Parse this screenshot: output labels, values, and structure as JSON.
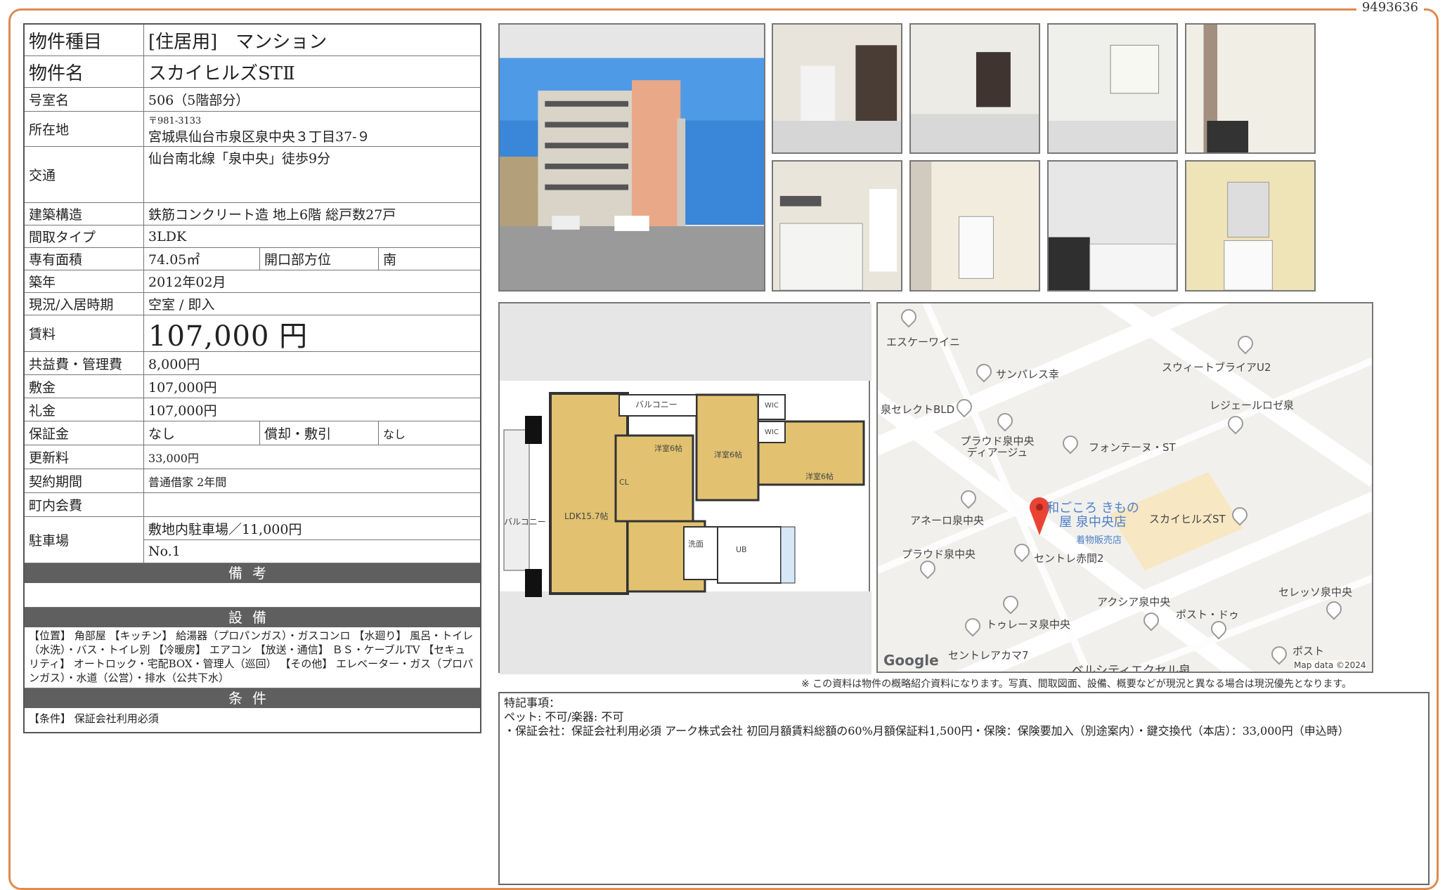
{
  "doc_id": "9493636",
  "spec": {
    "type_label": "物件種目",
    "type_value": "[住居用]　マンション",
    "name_label": "物件名",
    "name_value": "スカイヒルズSTⅡ",
    "room_label": "号室名",
    "room_value": "506（5階部分）",
    "address_label": "所在地",
    "postal": "〒981-3133",
    "address": "宮城県仙台市泉区泉中央３丁目37-９",
    "transit_label": "交通",
    "transit_value": "仙台南北線「泉中央」徒歩9分",
    "structure_label": "建築構造",
    "structure_value": "鉄筋コンクリート造 地上6階 総戸数27戸",
    "layout_label": "間取タイプ",
    "layout_value": "3LDK",
    "area_label": "専有面積",
    "area_value": "74.05㎡",
    "direction_label": "開口部方位",
    "direction_value": "南",
    "built_label": "築年",
    "built_value": "2012年02月",
    "status_label": "現況/入居時期",
    "status_value": "空室 / 即入",
    "rent_label": "賃料",
    "rent_value": "107,000 円",
    "fee_label": "共益費・管理費",
    "fee_value": "8,000円",
    "deposit_label": "敷金",
    "deposit_value": "107,000円",
    "keymoney_label": "礼金",
    "keymoney_value": "107,000円",
    "guarantee_label": "保証金",
    "guarantee_value": "なし",
    "amort_label": "償却・敷引",
    "amort_value": "なし",
    "renewal_label": "更新料",
    "renewal_value": "33,000円",
    "contract_label": "契約期間",
    "contract_value": "普通借家 2年間",
    "community_label": "町内会費",
    "community_value": "",
    "parking_label": "駐車場",
    "parking_value": "敷地内駐車場／11,000円",
    "parking_no": "No.1"
  },
  "sections": {
    "remarks_title": "備考",
    "facility_title": "設備",
    "facility_text": "【位置】 角部屋 【キッチン】 給湯器（プロパンガス）・ガスコンロ 【水廻り】 風呂・トイレ（水洗）・バス・トイレ別 【冷暖房】 エアコン 【放送・通信】 ＢＳ・ケーブルTV 【セキュリティ】 オートロック・宅配BOX・管理人（巡回） 【その他】 エレベーター・ガス（プロパンガス）・水道（公営）・排水（公共下水）",
    "condition_title": "条件",
    "condition_text": "【条件】 保証会社利用必須"
  },
  "floorplan": {
    "balcony_top": "バルコニー",
    "balcony_side": "バルコニー",
    "room1": "洋室6帖",
    "room2": "洋室6帖",
    "room3": "洋室6帖",
    "ldk": "LDK15.7帖",
    "cl": "CL",
    "wic1": "WIC",
    "wic2": "WIC",
    "wash": "洗面",
    "ub": "UB"
  },
  "map": {
    "labels": [
      "エスケーワイニ",
      "サンパレス幸",
      "泉セレクトBLD",
      "プラウド泉中央ディアージュ",
      "フォンテーヌ・ST",
      "スウィートブライアU2",
      "レジェールロゼ泉",
      "和ごころ きもの屋 泉中央店",
      "着物販売店",
      "スカイヒルズST",
      "アネーロ泉中央",
      "プラウド泉中央",
      "セントレ赤間2",
      "アクシア泉中央",
      "ポスト・ドゥ",
      "セレッソ泉中央",
      "トゥレーヌ泉中央",
      "セントレアカマ7",
      "ベルシティエクセル泉",
      "ポスト",
      "Google",
      "Map data ©2024"
    ]
  },
  "disclaimer": "※ この資料は物件の概略紹介資料になります。写真、間取図面、設備、概要などが現況と異なる場合は現況優先となります。",
  "remarks": {
    "title": "特記事項：",
    "line1": "ペット: 不可/楽器: 不可",
    "line2": "・保証会社：保証会社利用必須 アーク株式会社 初回月額賃料総額の60%月額保証料1,500円・保険：保険要加入（別途案内）・鍵交換代（本店）：33,000円（申込時）"
  }
}
